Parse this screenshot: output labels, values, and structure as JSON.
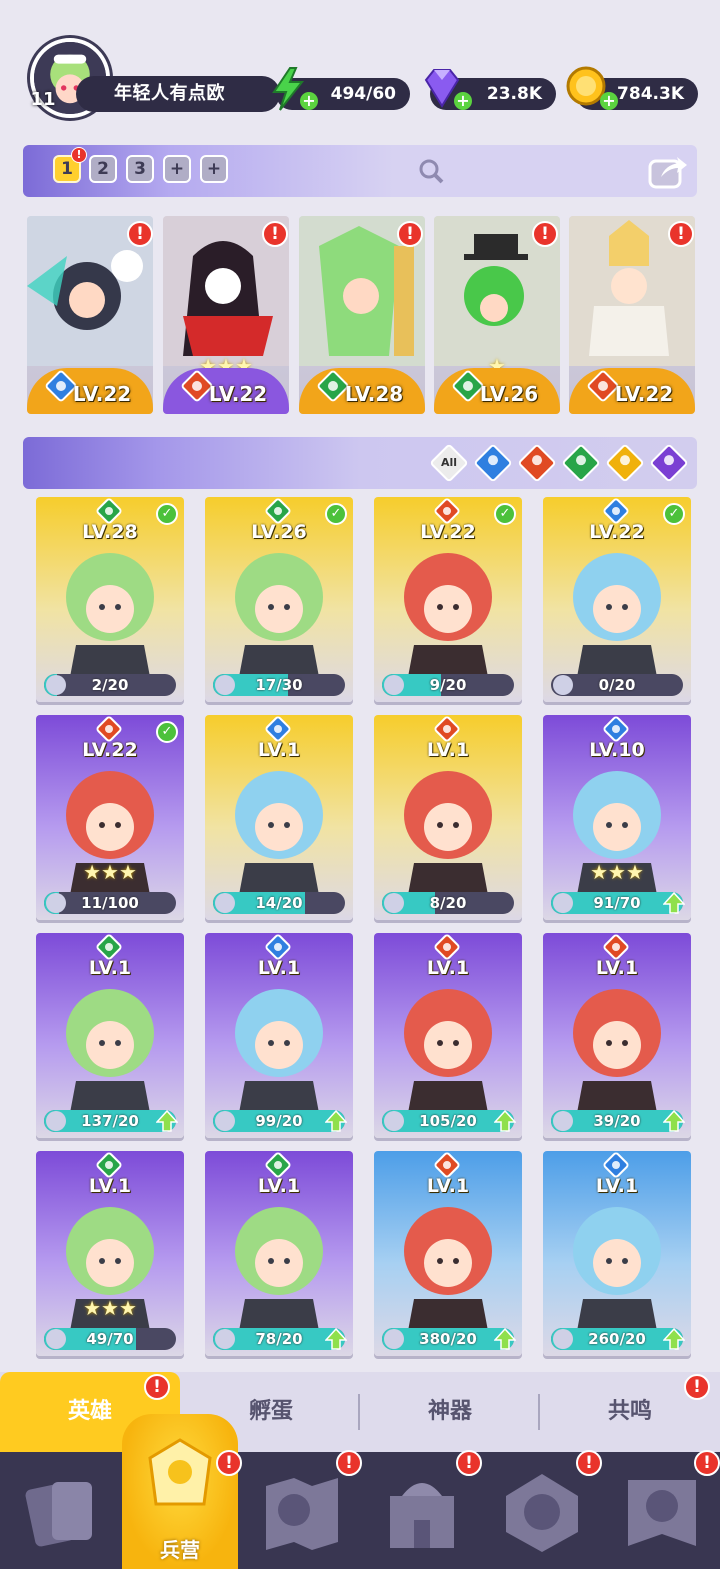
{
  "profile": {
    "level": "11",
    "name": "年轻人有点欧"
  },
  "resources": [
    {
      "name": "energy",
      "value": "494/60",
      "icon": "lightning-icon",
      "color": "#49d34a"
    },
    {
      "name": "gems",
      "value": "23.8K",
      "icon": "gem-icon",
      "color": "#8a5bf0"
    },
    {
      "name": "coins",
      "value": "784.3K",
      "icon": "coin-icon",
      "color": "#ffc21c"
    }
  ],
  "team_tabs": [
    {
      "label": "1",
      "active": true
    },
    {
      "label": "2",
      "active": false
    },
    {
      "label": "3",
      "active": false
    },
    {
      "label": "+",
      "active": false
    },
    {
      "label": "+",
      "active": false
    }
  ],
  "team_badge": "!",
  "team": [
    {
      "level": "LV.22",
      "element": "water",
      "bar": "gold"
    },
    {
      "level": "LV.22",
      "element": "fire",
      "bar": "purple",
      "stars": "★★★"
    },
    {
      "level": "LV.28",
      "element": "wind",
      "bar": "gold"
    },
    {
      "level": "LV.26",
      "element": "wind",
      "bar": "gold",
      "stars": "★"
    },
    {
      "level": "LV.22",
      "element": "fire",
      "bar": "gold"
    }
  ],
  "filter": {
    "all_label": "All",
    "elements": [
      "water",
      "fire",
      "wind",
      "light",
      "dark"
    ]
  },
  "heroes": [
    {
      "level": "LV.28",
      "element": "wind",
      "frame": "gold",
      "progress": "2/20",
      "ratio": 0.1,
      "check": true
    },
    {
      "level": "LV.26",
      "element": "wind",
      "frame": "gold",
      "progress": "17/30",
      "ratio": 0.57,
      "check": true
    },
    {
      "level": "LV.22",
      "element": "fire",
      "frame": "gold",
      "progress": "9/20",
      "ratio": 0.45,
      "check": true
    },
    {
      "level": "LV.22",
      "element": "water",
      "frame": "gold",
      "progress": "0/20",
      "ratio": 0.0,
      "check": true
    },
    {
      "level": "LV.22",
      "element": "fire",
      "frame": "violet",
      "progress": "11/100",
      "ratio": 0.11,
      "check": true,
      "stars": "★★★"
    },
    {
      "level": "LV.1",
      "element": "water",
      "frame": "gold",
      "progress": "14/20",
      "ratio": 0.7
    },
    {
      "level": "LV.1",
      "element": "fire",
      "frame": "gold",
      "progress": "8/20",
      "ratio": 0.4
    },
    {
      "level": "LV.10",
      "element": "water",
      "frame": "violet",
      "progress": "91/70",
      "ratio": 1.0,
      "upgrade": true,
      "stars": "★★★"
    },
    {
      "level": "LV.1",
      "element": "wind",
      "frame": "violet",
      "progress": "137/20",
      "ratio": 1.0,
      "upgrade": true
    },
    {
      "level": "LV.1",
      "element": "water",
      "frame": "violet",
      "progress": "99/20",
      "ratio": 1.0,
      "upgrade": true
    },
    {
      "level": "LV.1",
      "element": "fire",
      "frame": "violet",
      "progress": "105/20",
      "ratio": 1.0,
      "upgrade": true
    },
    {
      "level": "LV.1",
      "element": "fire",
      "frame": "violet",
      "progress": "39/20",
      "ratio": 1.0,
      "upgrade": true
    },
    {
      "level": "LV.1",
      "element": "wind",
      "frame": "violet",
      "progress": "49/70",
      "ratio": 0.7,
      "stars": "★★★"
    },
    {
      "level": "LV.1",
      "element": "wind",
      "frame": "violet",
      "progress": "78/20",
      "ratio": 1.0,
      "upgrade": true
    },
    {
      "level": "LV.1",
      "element": "fire",
      "frame": "blue",
      "progress": "380/20",
      "ratio": 1.0,
      "upgrade": true
    },
    {
      "level": "LV.1",
      "element": "water",
      "frame": "blue",
      "progress": "260/20",
      "ratio": 1.0,
      "upgrade": true
    }
  ],
  "subtabs": [
    {
      "label": "英雄",
      "active": true,
      "badge": true
    },
    {
      "label": "孵蛋",
      "active": false
    },
    {
      "label": "神器",
      "active": false
    },
    {
      "label": "共鸣",
      "active": false,
      "badge": true
    }
  ],
  "nav": [
    {
      "icon": "cards-icon",
      "label": "",
      "badge": false
    },
    {
      "icon": "barracks-icon",
      "label": "兵营",
      "badge": true,
      "active": true
    },
    {
      "icon": "map-icon",
      "label": "",
      "badge": true
    },
    {
      "icon": "castle-icon",
      "label": "",
      "badge": true
    },
    {
      "icon": "guild-icon",
      "label": "",
      "badge": true
    },
    {
      "icon": "banner-icon",
      "label": "",
      "badge": true
    }
  ],
  "badge_mark": "!"
}
